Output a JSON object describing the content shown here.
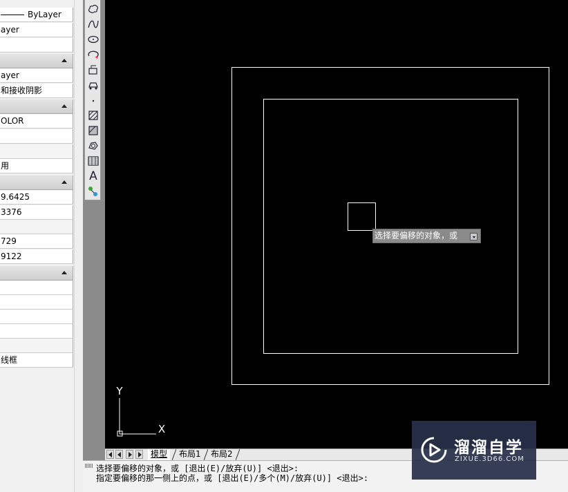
{
  "properties_panel": {
    "rows": [
      {
        "value": "ByLayer"
      },
      {
        "value": "ayer"
      },
      {
        "value": ""
      },
      {
        "value": "ayer"
      },
      {
        "value": "和接收阴影"
      },
      {
        "value": "OLOR"
      },
      {
        "value": ""
      },
      {
        "value": ""
      },
      {
        "value": "用"
      },
      {
        "value": "9.6425"
      },
      {
        "value": "3376"
      },
      {
        "value": ""
      },
      {
        "value": "729"
      },
      {
        "value": "9122"
      },
      {
        "value": ""
      },
      {
        "value": ""
      },
      {
        "value": ""
      },
      {
        "value": ""
      },
      {
        "value": ""
      },
      {
        "value": "线框"
      }
    ]
  },
  "toolbar": {
    "tools": [
      "revision-cloud-icon",
      "spline-icon",
      "ellipse-icon",
      "ellipse-arc-icon",
      "insert-block-icon",
      "make-block-icon",
      "point-icon",
      "hatch-icon",
      "gradient-icon",
      "region-icon",
      "table-icon",
      "multiline-text-icon",
      "add-selected-icon"
    ],
    "text_tool_label": "A"
  },
  "canvas": {
    "tooltip": "选择要偏移的对象，或",
    "ucs_x_label": "X",
    "ucs_y_label": "Y"
  },
  "tabs": {
    "items": [
      {
        "label": "模型",
        "active": true
      },
      {
        "label": "布局1",
        "active": false
      },
      {
        "label": "布局2",
        "active": false
      }
    ]
  },
  "command_line": {
    "lines": [
      "选择要偏移的对象，或 [退出(E)/放弃(U)] <退出>:",
      "指定要偏移的那一侧上的点，或 [退出(E)/多个(M)/放弃(U)] <退出>:"
    ]
  },
  "watermark": {
    "title": "溜溜自学",
    "url": "ZIXUE.3D66.COM"
  },
  "colors": {
    "canvas_bg": "#000000",
    "geometry": "#ffffff",
    "watermark_bg": "#28304a"
  }
}
